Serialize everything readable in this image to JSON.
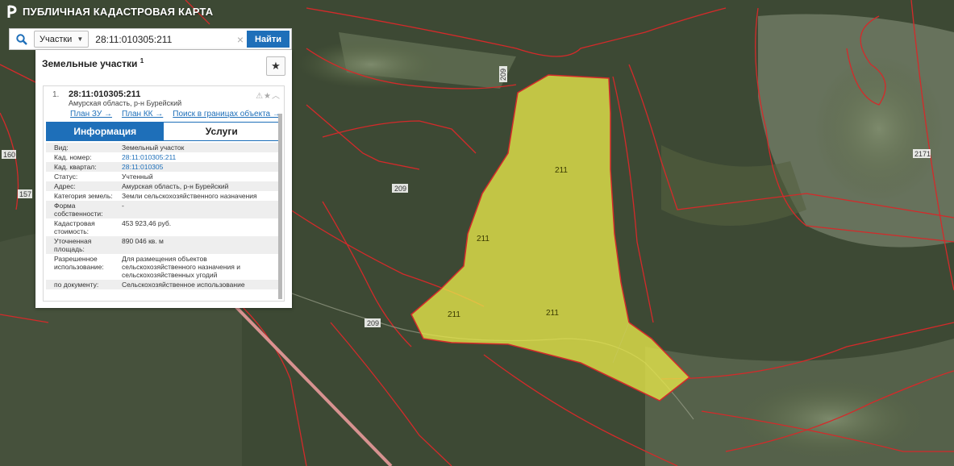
{
  "header": {
    "title": "ПУБЛИЧНАЯ КАДАСТРОВАЯ КАРТА"
  },
  "search": {
    "type_label": "Участки",
    "value": "28:11:010305:211",
    "button_label": "Найти"
  },
  "panel": {
    "title": "Земельные участки",
    "title_count": "1",
    "result": {
      "index": "1.",
      "cadnum": "28:11:010305:211",
      "address": "Амурская область, р-н Бурейский",
      "links": [
        "План ЗУ →",
        "План КК →",
        "Поиск в границах объекта →"
      ],
      "tabs": [
        "Информация",
        "Услуги"
      ],
      "rows": [
        {
          "key": "Вид:",
          "value": "Земельный участок"
        },
        {
          "key": "Кад. номер:",
          "value": "28:11:010305:211"
        },
        {
          "key": "Кад. квартал:",
          "value": "28:11:010305"
        },
        {
          "key": "Статус:",
          "value": "Учтенный"
        },
        {
          "key": "Адрес:",
          "value": "Амурская область, р-н Бурейский"
        },
        {
          "key": "Категория земель:",
          "value": "Земли сельскохозяйственного назначения"
        },
        {
          "key": "Форма собственности:",
          "value": "-"
        },
        {
          "key": "Кадастровая стоимость:",
          "value": "453 923,46 руб."
        },
        {
          "key": "Уточненная площадь:",
          "value": "890 046 кв. м"
        },
        {
          "key": "Разрешенное использование:",
          "value": "Для размещения объектов сельскохозяйственного назначения и сельскохозяйственных угодий"
        },
        {
          "key": "по документу:",
          "value": "Сельскохозяйственное использование"
        }
      ]
    }
  },
  "map": {
    "parcel_labels": [
      "211",
      "211",
      "211",
      "211"
    ],
    "boundary_labels": [
      "209",
      "209",
      "209",
      "160",
      "157",
      "2171"
    ]
  },
  "colors": {
    "parcel_fill": "#e8e84a",
    "boundary": "#d42a2a",
    "accent": "#1e6fb9"
  }
}
